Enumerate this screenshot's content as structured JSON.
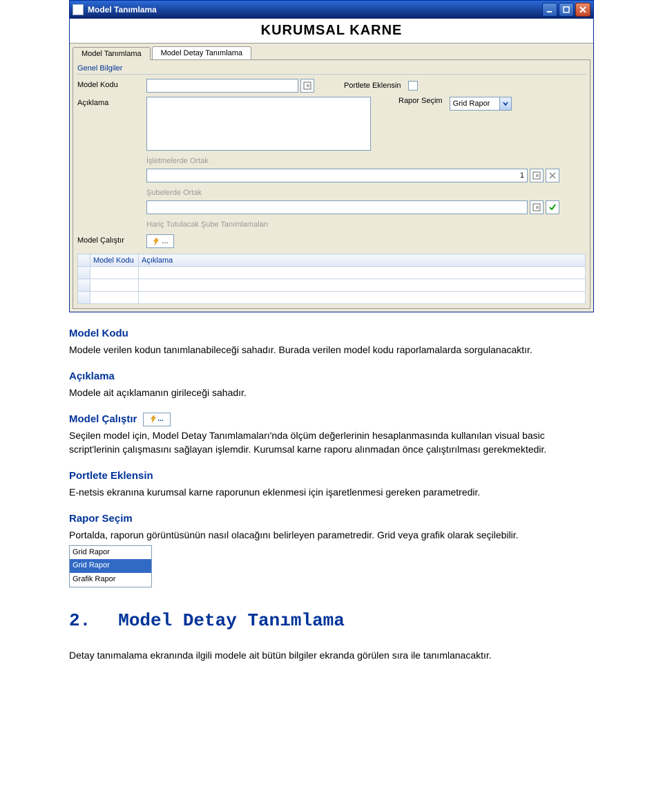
{
  "window": {
    "title": "Model Tanımlama",
    "appTitle": "KURUMSAL KARNE"
  },
  "tabs": [
    "Model Tanımlama",
    "Model Detay Tanımlama"
  ],
  "form": {
    "group": "Genel Bilgiler",
    "modelKoduLabel": "Model Kodu",
    "modelKoduValue": "",
    "portleteLabel": "Portlete Eklensin",
    "raporSecimLabel": "Rapor Seçim",
    "raporSecimValue": "Grid Rapor",
    "aciklamaLabel": "Açıklama",
    "aciklamaValue": "",
    "isletmelerdeLabel": "İşletmelerde Ortak",
    "isletmelerdeValue": "1",
    "subelerdeLabel": "Şubelerde Ortak",
    "subelerdeValue": "",
    "haricLabel": "Hariç Tutulacak Şube Tanımlamaları",
    "modelCalistirLabel": "Model Çalıştır",
    "modelCalistirBtn": "..."
  },
  "grid": {
    "col1": "Model Kodu",
    "col2": "Açıklama"
  },
  "doc": {
    "modelKodu": {
      "h": "Model Kodu",
      "p": "Modele verilen kodun tanımlanabileceği sahadır. Burada verilen model kodu raporlamalarda sorgulanacaktır."
    },
    "aciklama": {
      "h": "Açıklama",
      "p": "Modele ait açıklamanın girileceği sahadır."
    },
    "modelCalistir": {
      "h": "Model Çalıştır",
      "btn": "...",
      "p": "Seçilen model için, Model Detay Tanımlamaları'nda ölçüm değerlerinin hesaplanmasında kullanılan visual basic script'lerinin çalışmasını sağlayan işlemdir. Kurumsal karne raporu alınmadan önce çalıştırılması gerekmektedir."
    },
    "portlete": {
      "h": "Portlete Eklensin",
      "p": "E-netsis ekranına kurumsal karne raporunun eklenmesi için işaretlenmesi gereken parametredir."
    },
    "raporSecim": {
      "h": "Rapor Seçim",
      "p": "Portalda, raporun görüntüsünün nasıl olacağını belirleyen parametredir. Grid veya grafik olarak seçilebilir."
    },
    "dropdown": [
      "Grid Rapor",
      "Grid Rapor",
      "Grafik Rapor"
    ]
  },
  "section2": {
    "num": "2.",
    "title": "Model Detay Tanımlama",
    "p": "Detay tanımalama ekranında ilgili modele ait bütün bilgiler ekranda görülen sıra ile tanımlanacaktır."
  }
}
